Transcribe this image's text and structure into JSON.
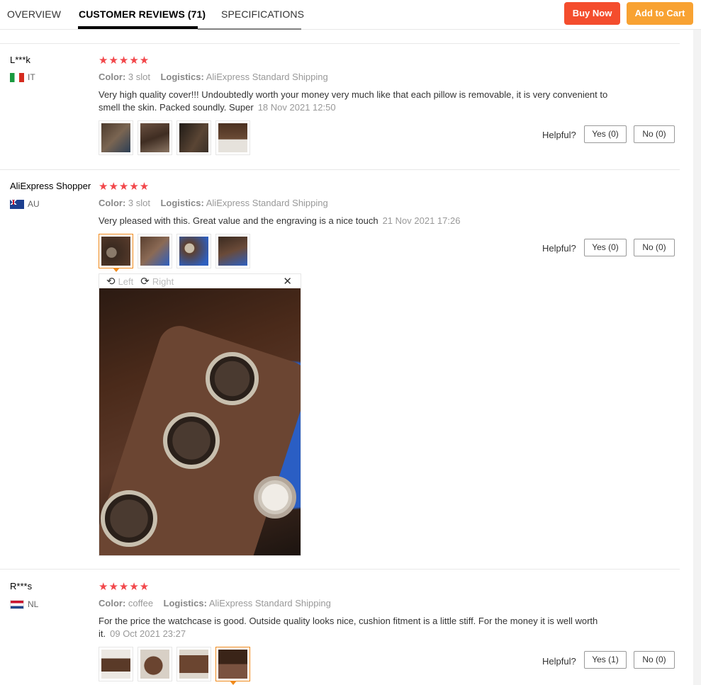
{
  "tabs": {
    "overview": "OVERVIEW",
    "reviews": "CUSTOMER REVIEWS (71)",
    "specs": "SPECIFICATIONS"
  },
  "actions": {
    "buy_now": "Buy Now",
    "add_to_cart": "Add to Cart"
  },
  "colors": {
    "buy_now": "#f44d2d",
    "add_to_cart": "#f8a232",
    "stars": "#f2474b",
    "selected_thumb": "#f08a1c"
  },
  "labels": {
    "color": "Color:",
    "logistics": "Logistics:",
    "helpful": "Helpful?"
  },
  "reviews": [
    {
      "user": "L***k",
      "country": "IT",
      "stars": "★★★★★",
      "rating": 5,
      "color_value": "3 slot",
      "logistics_value": "AliExpress Standard Shipping",
      "text": "Very high quality cover!!! Undoubtedly worth your money very much like that each pillow is removable, it is very convenient to smell the skin. Packed soundly. Super",
      "date": "18 Nov 2021 12:50",
      "yes": "Yes (0)",
      "no": "No (0)"
    },
    {
      "user": "AliExpress Shopper",
      "country": "AU",
      "stars": "★★★★★",
      "rating": 5,
      "color_value": "3 slot",
      "logistics_value": "AliExpress Standard Shipping",
      "text": "Very pleased with this. Great value and the engraving is a nice touch",
      "date": "21 Nov 2021 17:26",
      "yes": "Yes (0)",
      "no": "No (0)"
    },
    {
      "user": "R***s",
      "country": "NL",
      "stars": "★★★★★",
      "rating": 5,
      "color_value": "coffee",
      "logistics_value": "AliExpress Standard Shipping",
      "text": "For the price the watchcase is good. Outside quality looks nice, cushion fitment is a little stiff. For the money it is well worth it.",
      "date": "09 Oct 2021 23:27",
      "yes": "Yes (1)",
      "no": "No (0)"
    }
  ],
  "viewer": {
    "rotate_left": "Left",
    "rotate_right": "Right",
    "close": "✕"
  }
}
